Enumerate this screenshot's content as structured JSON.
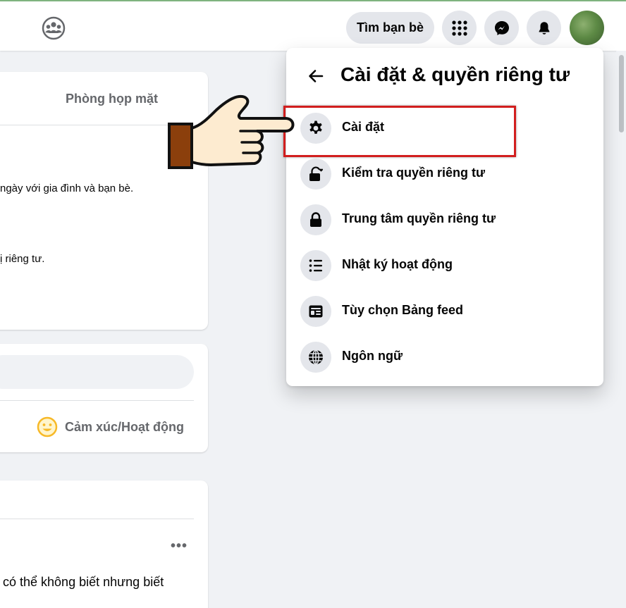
{
  "topbar": {
    "find_friends_label": "Tìm bạn bè",
    "icons": [
      "groups-icon",
      "menu-grid-icon",
      "messenger-icon",
      "bell-icon",
      "avatar"
    ]
  },
  "left_cards": {
    "room_tab": "Phòng họp mặt",
    "line_family": "ngày với gia đình và bạn bè.",
    "line_privacy": "ị riêng tư.",
    "feeling_label": "Cảm xúc/Hoạt động",
    "more_label": "•••",
    "post_fragment": "có thể không biết nhưng biết"
  },
  "menu": {
    "title": "Cài đặt & quyền riêng tư",
    "items": [
      {
        "label": "Cài đặt",
        "icon": "gear-icon"
      },
      {
        "label": "Kiểm tra quyền riêng tư",
        "icon": "lock-heart-icon"
      },
      {
        "label": "Trung tâm quyền riêng tư",
        "icon": "lock-icon"
      },
      {
        "label": "Nhật ký hoạt động",
        "icon": "list-icon"
      },
      {
        "label": "Tùy chọn Bảng feed",
        "icon": "feed-icon"
      },
      {
        "label": "Ngôn ngữ",
        "icon": "globe-icon"
      }
    ]
  },
  "colors": {
    "highlight": "#d21e1e",
    "icon_bg": "#e4e6eb",
    "page_bg": "#f0f2f5",
    "hand_fill": "#fdebd0",
    "sleeve": "#8b3f0c"
  }
}
